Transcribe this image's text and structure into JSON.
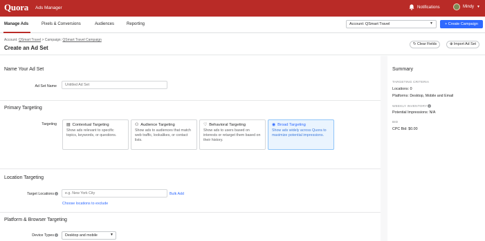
{
  "topbar": {
    "logo": "Quora",
    "app_name": "Ads Manager",
    "notifications": "Notifications",
    "user_name": "Mindy",
    "user_caret": "▼"
  },
  "nav": {
    "tabs": [
      {
        "label": "Manage Ads"
      },
      {
        "label": "Pixels & Conversions"
      },
      {
        "label": "Audiences"
      },
      {
        "label": "Reporting"
      }
    ],
    "account_select": "Account: QSmart Travel",
    "account_caret": "▼",
    "create_campaign": "+ Create Campaign"
  },
  "header": {
    "breadcrumb_account_prefix": "Account: ",
    "breadcrumb_account": "QSmart Travel",
    "breadcrumb_sep": " > Campaign: ",
    "breadcrumb_campaign": "QSmart Travel Campaign",
    "title": "Create an Ad Set",
    "clear_fields": "Clear Fields",
    "import_ad_set": "Import Ad Set"
  },
  "name_section": {
    "title": "Name Your Ad Set",
    "label": "Ad Set Name",
    "placeholder": "Untitled Ad Set"
  },
  "primary_targeting": {
    "title": "Primary Targeting",
    "label": "Targeting",
    "cards": [
      {
        "title": "Contextual Targeting",
        "desc": "Show ads relevant to specific topics, keywords, or questions."
      },
      {
        "title": "Audience Targeting",
        "desc": "Show ads to audiences that match web traffic, lookalikes, or contact lists."
      },
      {
        "title": "Behavioral Targeting",
        "desc": "Show ads to users based on interests or retarget them based on their history."
      },
      {
        "title": "Broad Targeting",
        "desc": "Show ads widely across Quora to maximize potential impressions."
      }
    ]
  },
  "location": {
    "title": "Location Targeting",
    "label": "Target Locations",
    "placeholder": "e.g. New York City",
    "bulk_add": "Bulk Add",
    "exclude_link": "Choose locations to exclude"
  },
  "platform": {
    "title": "Platform & Browser Targeting",
    "label": "Device Types",
    "device_value": "Desktop and mobile",
    "device_caret": "▼"
  },
  "summary": {
    "title": "Summary",
    "targeting_caption": "TARGETING CRITERIA",
    "locations": "Locations: 0",
    "platforms": "Platforms: Desktop, Mobile and Email",
    "inventory_caption": "WEEKLY INVENTORY",
    "impressions": "Potential Impressions: N/A",
    "bid_caption": "BID",
    "cpc_bid": "CPC Bid: $0.00"
  },
  "colors": {
    "brand_red": "#b92b27",
    "primary_blue": "#2e69ff",
    "selected_card_bg": "#eaf4fe"
  }
}
